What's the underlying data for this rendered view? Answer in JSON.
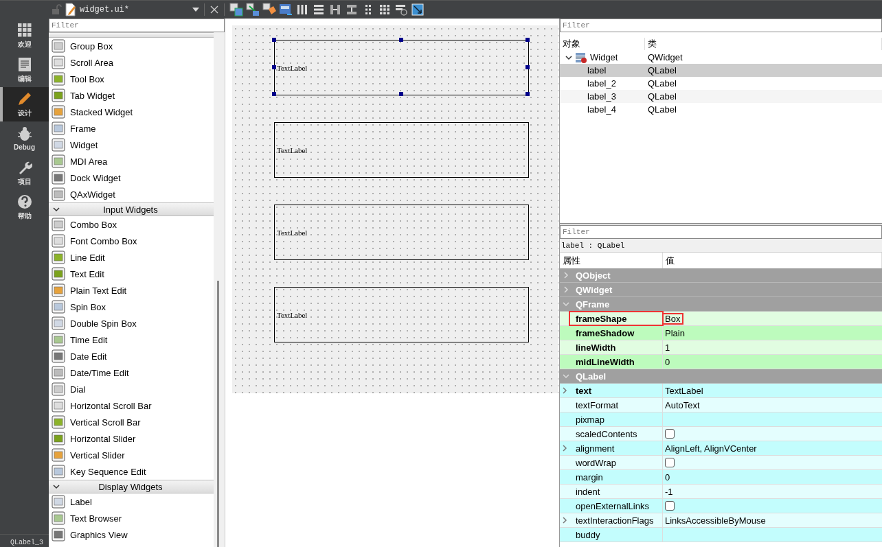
{
  "file_tab": {
    "title": "widget.ui*"
  },
  "mode_bar": {
    "items": [
      {
        "label": "欢迎",
        "selected": false
      },
      {
        "label": "编辑",
        "selected": false
      },
      {
        "label": "设计",
        "selected": true
      },
      {
        "label": "Debug",
        "selected": false
      },
      {
        "label": "项目",
        "selected": false
      },
      {
        "label": "帮助",
        "selected": false
      }
    ],
    "status": "QLabel_3"
  },
  "widget_box": {
    "filter_placeholder": "Filter",
    "sections": [
      {
        "expanded": true,
        "items": [
          "Group Box",
          "Scroll Area",
          "Tool Box",
          "Tab Widget",
          "Stacked Widget",
          "Frame",
          "Widget",
          "MDI Area",
          "Dock Widget",
          "QAxWidget"
        ]
      },
      {
        "title": "Input Widgets",
        "expanded": true,
        "items": [
          "Combo Box",
          "Font Combo Box",
          "Line Edit",
          "Text Edit",
          "Plain Text Edit",
          "Spin Box",
          "Double Spin Box",
          "Time Edit",
          "Date Edit",
          "Date/Time Edit",
          "Dial",
          "Horizontal Scroll Bar",
          "Vertical Scroll Bar",
          "Horizontal Slider",
          "Vertical Slider",
          "Key Sequence Edit"
        ]
      },
      {
        "title": "Display Widgets",
        "expanded": true,
        "items": [
          "Label",
          "Text Browser",
          "Graphics View"
        ]
      }
    ]
  },
  "form": {
    "labels": [
      {
        "text": "TextLabel",
        "selected": true
      },
      {
        "text": "TextLabel",
        "selected": false
      },
      {
        "text": "TextLabel",
        "selected": false
      },
      {
        "text": "TextLabel",
        "selected": false
      }
    ]
  },
  "object_inspector": {
    "filter_placeholder": "Filter",
    "columns": [
      "对象",
      "类"
    ],
    "tree": [
      {
        "name": "Widget",
        "class": "QWidget",
        "expanded": true,
        "selected": false,
        "children": [
          {
            "name": "label",
            "class": "QLabel",
            "selected": true
          },
          {
            "name": "label_2",
            "class": "QLabel",
            "selected": false
          },
          {
            "name": "label_3",
            "class": "QLabel",
            "selected": false
          },
          {
            "name": "label_4",
            "class": "QLabel",
            "selected": false
          }
        ]
      }
    ]
  },
  "property_editor": {
    "filter_placeholder": "Filter",
    "object": "label : QLabel",
    "columns": [
      "属性",
      "值"
    ],
    "groups": [
      {
        "name": "QObject",
        "expanded": false
      },
      {
        "name": "QWidget",
        "expanded": false
      },
      {
        "name": "QFrame",
        "expanded": true,
        "color": "#bdfbbd",
        "properties": [
          {
            "name": "frameShape",
            "kind": "text",
            "value": "Box",
            "modified": true,
            "expandable": false,
            "highlighted": true
          },
          {
            "name": "frameShadow",
            "kind": "text",
            "value": "Plain",
            "modified": true,
            "expandable": false,
            "highlighted": false
          },
          {
            "name": "lineWidth",
            "kind": "text",
            "value": "1",
            "modified": true,
            "expandable": false,
            "highlighted": false
          },
          {
            "name": "midLineWidth",
            "kind": "text",
            "value": "0",
            "modified": true,
            "expandable": false,
            "highlighted": false
          }
        ]
      },
      {
        "name": "QLabel",
        "expanded": true,
        "color": "#c3fdfd",
        "properties": [
          {
            "name": "text",
            "kind": "text",
            "value": "TextLabel",
            "modified": true,
            "expandable": true,
            "highlighted": false
          },
          {
            "name": "textFormat",
            "kind": "text",
            "value": "AutoText",
            "modified": false,
            "expandable": false,
            "highlighted": false
          },
          {
            "name": "pixmap",
            "kind": "text",
            "modified": false,
            "expandable": false,
            "highlighted": false
          },
          {
            "name": "scaledContents",
            "kind": "checkbox",
            "checked": false,
            "modified": false,
            "expandable": false,
            "highlighted": false
          },
          {
            "name": "alignment",
            "kind": "text",
            "value": "AlignLeft, AlignVCenter",
            "modified": false,
            "expandable": true,
            "highlighted": false
          },
          {
            "name": "wordWrap",
            "kind": "checkbox",
            "checked": false,
            "modified": false,
            "expandable": false,
            "highlighted": false
          },
          {
            "name": "margin",
            "kind": "text",
            "value": "0",
            "modified": false,
            "expandable": false,
            "highlighted": false
          },
          {
            "name": "indent",
            "kind": "text",
            "value": "-1",
            "modified": false,
            "expandable": false,
            "highlighted": false
          },
          {
            "name": "openExternalLinks",
            "kind": "checkbox",
            "checked": false,
            "modified": false,
            "expandable": false,
            "highlighted": false
          },
          {
            "name": "textInteractionFlags",
            "kind": "text",
            "value": "LinksAccessibleByMouse",
            "modified": false,
            "expandable": true,
            "highlighted": false
          },
          {
            "name": "buddy",
            "kind": "text",
            "modified": false,
            "expandable": false,
            "highlighted": false
          }
        ]
      }
    ]
  }
}
